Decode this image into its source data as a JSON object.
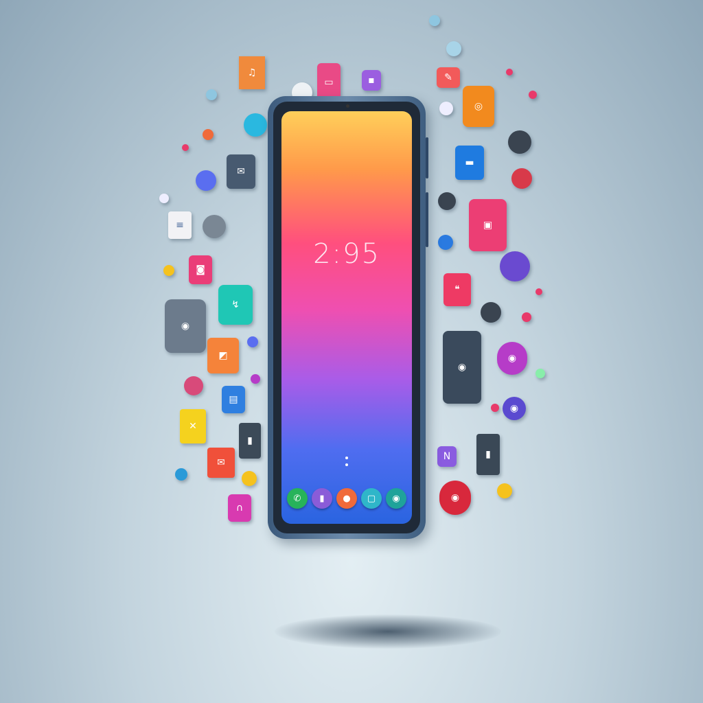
{
  "phone": {
    "clock_text": "2:95",
    "dock_apps": [
      {
        "icon": "phone-icon",
        "color": "#27b35a",
        "glyph": "✆"
      },
      {
        "icon": "notes-icon",
        "color": "#8a5cd8",
        "glyph": "▮"
      },
      {
        "icon": "browser-icon",
        "color": "#f06a3a",
        "glyph": "●"
      },
      {
        "icon": "messages-icon",
        "color": "#2fb6c9",
        "glyph": "▢"
      },
      {
        "icon": "camera-icon",
        "color": "#1fa39a",
        "glyph": "◉"
      }
    ]
  },
  "floating_icons": [
    {
      "icon": "music-note-icon",
      "color": "#f08a3c",
      "glyph": "♫"
    },
    {
      "icon": "video-app-icon",
      "color": "#e94a86",
      "glyph": "▭"
    },
    {
      "icon": "chat-icon",
      "color": "#9b5ee0",
      "glyph": "▪"
    },
    {
      "icon": "pencil-icon",
      "color": "#f25a5a",
      "glyph": "✎"
    },
    {
      "icon": "instagram-icon",
      "color": "#f28a1e",
      "glyph": "◎"
    },
    {
      "icon": "mail-icon",
      "color": "#475a70",
      "glyph": "✉"
    },
    {
      "icon": "message-icon",
      "color": "#1f7be0",
      "glyph": "▬"
    },
    {
      "icon": "notes-icon",
      "color": "#f2f2f5",
      "glyph": "≡"
    },
    {
      "icon": "photo-app-icon",
      "color": "#ec3e74",
      "glyph": "▣"
    },
    {
      "icon": "gallery-icon",
      "color": "#ea3d78",
      "glyph": "◙"
    },
    {
      "icon": "maps-icon",
      "color": "#1fc7b5",
      "glyph": "↯"
    },
    {
      "icon": "camera-icon",
      "color": "#6c7b8c",
      "glyph": "◉"
    },
    {
      "icon": "chat-bubble-icon",
      "color": "#ee3a64",
      "glyph": "❝"
    },
    {
      "icon": "sticker-icon",
      "color": "#f5833a",
      "glyph": "◩"
    },
    {
      "icon": "camera-icon",
      "color": "#3a4a5c",
      "glyph": "◉"
    },
    {
      "icon": "files-icon",
      "color": "#2f7fe0",
      "glyph": "▤"
    },
    {
      "icon": "close-app-icon",
      "color": "#f5d21e",
      "glyph": "✕"
    },
    {
      "icon": "email-icon",
      "color": "#f0503a",
      "glyph": "✉"
    },
    {
      "icon": "wallet-icon",
      "color": "#3c4a58",
      "glyph": "▮"
    },
    {
      "icon": "app-icon",
      "color": "#8a5ce0",
      "glyph": "N"
    },
    {
      "icon": "wallet-icon",
      "color": "#3a4856",
      "glyph": "▮"
    },
    {
      "icon": "link-icon",
      "color": "#d83ab0",
      "glyph": "∩"
    },
    {
      "icon": "lens-icon",
      "color": "#5a4ad0",
      "glyph": "◉"
    },
    {
      "icon": "lens-icon",
      "color": "#b63cc8",
      "glyph": "◉"
    },
    {
      "icon": "record-icon",
      "color": "#d8283c",
      "glyph": "◉"
    }
  ]
}
